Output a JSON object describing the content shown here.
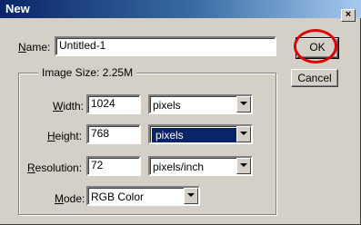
{
  "dialog": {
    "title": "New",
    "close_glyph": "×"
  },
  "name": {
    "label_key": "N",
    "label_rest": "ame:",
    "value": "Untitled-1"
  },
  "image_size": {
    "label": "Image Size:",
    "value": "2.25M"
  },
  "width": {
    "label_key": "W",
    "label_rest": "idth:",
    "value": "1024",
    "unit": "pixels"
  },
  "height": {
    "label_key": "H",
    "label_rest": "eight:",
    "value": "768",
    "unit": "pixels"
  },
  "resolution": {
    "label_key": "R",
    "label_rest": "esolution:",
    "value": "72",
    "unit": "pixels/inch"
  },
  "mode": {
    "label_key": "M",
    "label_rest": "ode:",
    "value": "RGB Color"
  },
  "buttons": {
    "ok": "OK",
    "cancel": "Cancel"
  },
  "annotation": {
    "color": "#e00000",
    "shape": "circle",
    "target": "ok-button"
  }
}
